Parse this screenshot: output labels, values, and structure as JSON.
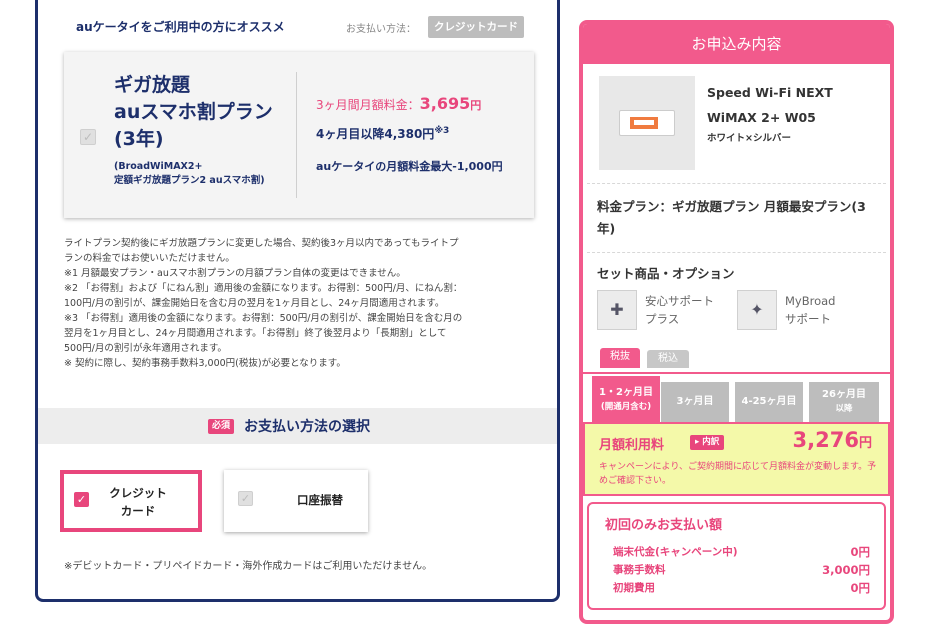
{
  "left": {
    "recommend_label": "auケータイをご利用中の方にオススメ",
    "payment_method_label": "お支払い方法：",
    "payment_method_badge": "クレジットカード",
    "plan": {
      "title_lines": [
        "ギガ放題",
        "auスマホ割プラン",
        "(3年)"
      ],
      "sub_lines": [
        "(BroadWiMAX2+",
        "定額ギガ放題プラン2 auスマホ割)"
      ],
      "price_label": "3ヶ月間月額料金：",
      "price_value": "3,695",
      "price_unit": "円",
      "later_text": "4ヶ月目以降4,380円",
      "later_note": "※3",
      "discount_text": "auケータイの月額料金最大-1,000円"
    },
    "notes": [
      "ライトプラン契約後にギガ放題プランに変更した場合、契約後3ヶ月以内であってもライトプ",
      "ランの料金ではお使いいただけません。",
      "※1 月額最安プラン・auスマホ割プランの月額プラン自体の変更はできません。",
      "※2 「お得割」および「にねん割」適用後の金額になります。お得割：500円/月、にねん割：",
      "100円/月の割引が、課金開始日を含む月の翌月を1ヶ月目とし、24ヶ月間適用されます。",
      "※3 「お得割」適用後の金額になります。お得割：500円/月の割引が、課金開始日を含む月の",
      "翌月を1ヶ月目とし、24ヶ月間適用されます。「お得割」終了後翌月より「長期割」として",
      "500円/月の割引が永年適用されます。",
      "※ 契約に際し、契約事務手数料3,000円(税抜)が必要となります。"
    ],
    "required_badge": "必須",
    "section_title": "お支払い方法の選択",
    "pay_credit_lines": [
      "クレジット",
      "カード"
    ],
    "pay_bank": "口座振替",
    "pay_note": "※デビットカード・プリペイドカード・海外作成カードはご利用いただけません。"
  },
  "right": {
    "header": "お申込み内容",
    "product_name_lines": [
      "Speed Wi-Fi NEXT",
      "WiMAX 2+ W05"
    ],
    "product_color": "ホワイト×シルバー",
    "plan_text": "料金プラン：ギガ放題プラン 月額最安プラン(3年)",
    "options_title": "セット商品・オプション",
    "options": [
      {
        "icon": "support-icon",
        "lines": [
          "安心サポート",
          "プラス"
        ]
      },
      {
        "icon": "mybroad-icon",
        "lines": [
          "MyBroad",
          "サポート"
        ]
      }
    ],
    "tax_tabs": [
      "税抜",
      "税込"
    ],
    "period_tabs": [
      {
        "label": "1・2ヶ月目",
        "sub": "(開通月含む)"
      },
      {
        "label": "3ヶ月目"
      },
      {
        "label": "4-25ヶ月目"
      },
      {
        "label": "26ヶ月目",
        "sub": "以降"
      }
    ],
    "monthly_label": "月額利用料",
    "breakdown_badge": "内訳",
    "monthly_value": "3,276",
    "monthly_unit": "円",
    "monthly_note": "キャンペーンにより、ご契約期間に応じて月額料金が変動します。予めご確認下さい。",
    "first_title": "初回のみお支払い額",
    "first_items": [
      {
        "label": "端末代金(キャンペーン中)",
        "value": "0円"
      },
      {
        "label": "事務手数料",
        "value": "3,000円"
      },
      {
        "label": "初期費用",
        "value": "0円"
      }
    ]
  }
}
